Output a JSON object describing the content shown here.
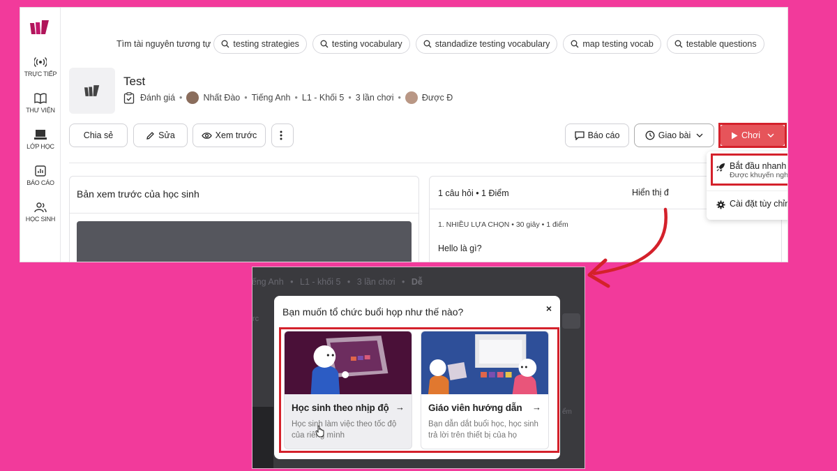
{
  "colors": {
    "background": "#f23a9b",
    "highlight": "#d4212b",
    "play_button": "#e6545a",
    "brand": "#b0155a"
  },
  "sidebar": {
    "items": [
      {
        "label": "TRỰC TIẾP",
        "icon": "live-broadcast-icon"
      },
      {
        "label": "THƯ VIỆN",
        "icon": "book-icon"
      },
      {
        "label": "LỚP HỌC",
        "icon": "laptop-icon"
      },
      {
        "label": "BÁO CÁO",
        "icon": "report-chart-icon"
      },
      {
        "label": "HỌC SINH",
        "icon": "users-icon"
      }
    ]
  },
  "related": {
    "label": "Tìm tài nguyên tương tự",
    "chips": [
      "testing strategies",
      "testing vocabulary",
      "standadize testing vocabulary",
      "map testing vocab",
      "testable questions"
    ]
  },
  "quiz": {
    "title": "Test",
    "assessment": "Đánh giá",
    "author": "Nhất Đào",
    "subject": "Tiếng Anh",
    "grade": "L1 - Khối 5",
    "plays": "3 lần chơi",
    "shared": "Được Đ"
  },
  "toolbar": {
    "share": "Chia sẻ",
    "edit": "Sửa",
    "preview": "Xem trước",
    "report": "Báo cáo",
    "assign": "Giao bài",
    "play": "Chơi"
  },
  "preview_card": {
    "title": "Bản xem trước của học sinh"
  },
  "questions_card": {
    "count": "1 câu hỏi • 1 Điểm",
    "show": "Hiển thị đ",
    "question_type": "1. NHIỀU LỰA CHỌN • 30 giây • 1 điểm",
    "question_text": "Hello là gì?"
  },
  "play_menu": {
    "quick_start": "Bắt đầu nhanh",
    "recommended": "Được khuyến nghị",
    "custom": "Cài đặt tùy chỉnh"
  },
  "modal_background": {
    "meta_subject": "iếng Anh",
    "meta_grade": "L1 - khối 5",
    "meta_plays": "3 lần chơi",
    "meta_tail": "Dễ",
    "left_fragment": "rc",
    "right_fragment": "ểm"
  },
  "modal": {
    "title": "Bạn muốn tổ chức buổi họp như thế nào?",
    "close": "×",
    "options": [
      {
        "title": "Học sinh theo nhịp độ",
        "arrow": "→",
        "desc": "Học sinh làm việc theo tốc độ của riêng mình"
      },
      {
        "title": "Giáo viên hướng dẫn",
        "arrow": "→",
        "desc": "Bạn dẫn dắt buổi học, học sinh trả lời trên thiết bị của họ"
      }
    ]
  }
}
